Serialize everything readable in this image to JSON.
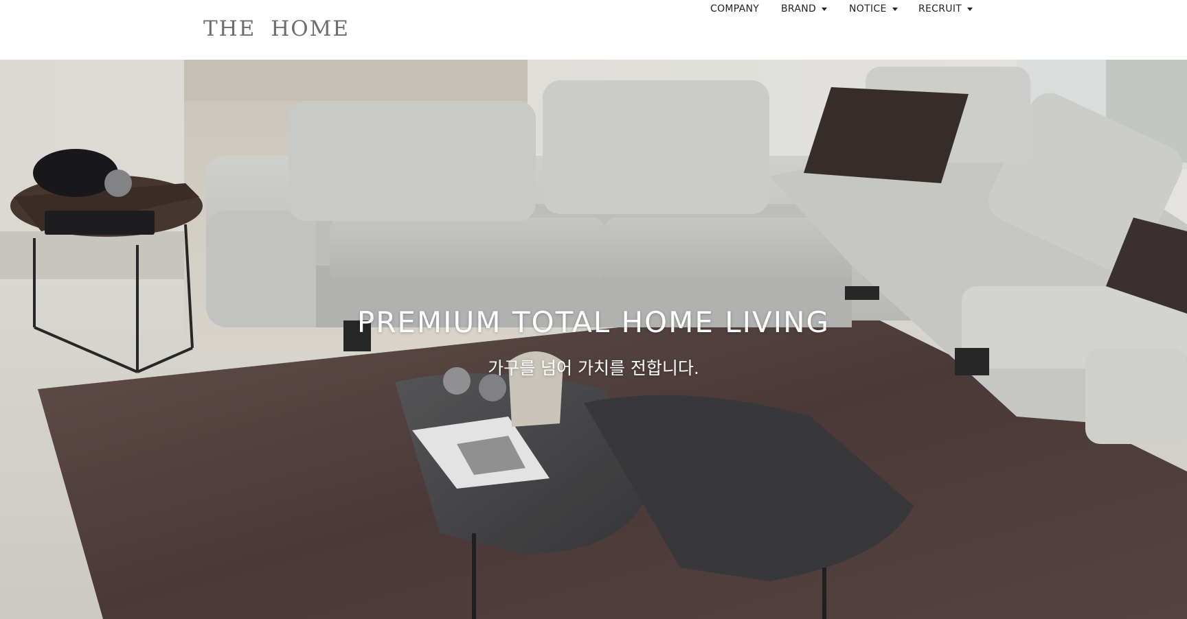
{
  "header": {
    "logo": "THE HOME",
    "nav": [
      {
        "label": "COMPANY",
        "has_dropdown": false
      },
      {
        "label": "BRAND",
        "has_dropdown": true
      },
      {
        "label": "NOTICE",
        "has_dropdown": true
      },
      {
        "label": "RECRUIT",
        "has_dropdown": true
      }
    ]
  },
  "hero": {
    "title": "PREMIUM TOTAL HOME LIVING",
    "subtitle": "가구를 넘어 가치를 전합니다."
  },
  "colors": {
    "header_bg": "#ffffff",
    "logo": "#6e6e6e",
    "nav_text": "#222222",
    "hero_text": "#ffffff"
  }
}
